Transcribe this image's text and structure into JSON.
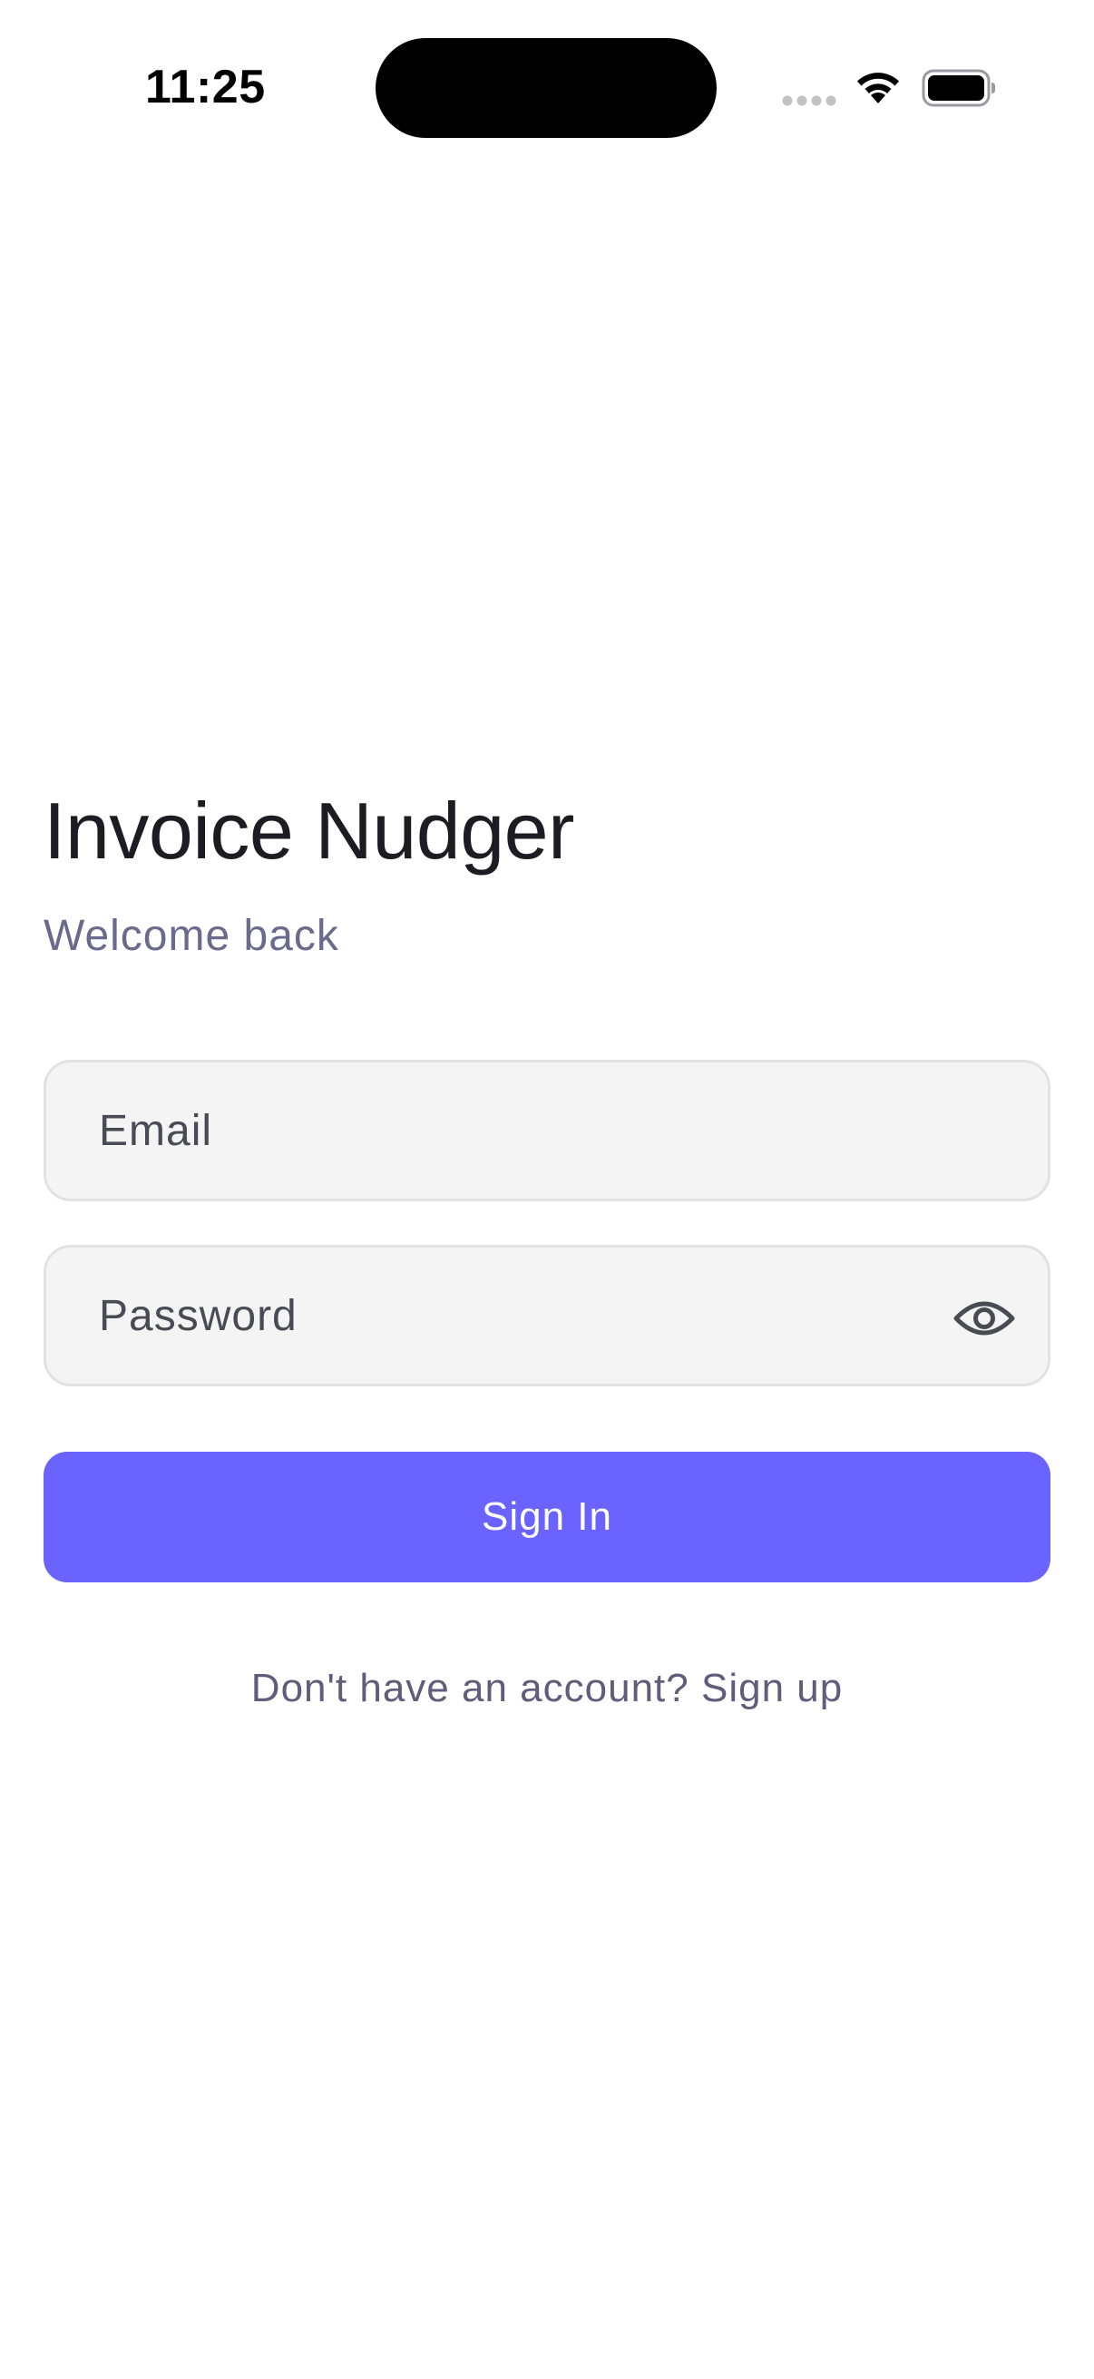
{
  "status_bar": {
    "time": "11:25",
    "icons": [
      "cellular-signal-icon",
      "wifi-icon",
      "battery-icon"
    ]
  },
  "header": {
    "title": "Invoice Nudger",
    "subtitle": "Welcome back"
  },
  "form": {
    "email": {
      "placeholder": "Email",
      "value": ""
    },
    "password": {
      "placeholder": "Password",
      "value": "",
      "toggle_icon": "eye-icon"
    },
    "submit_label": "Sign In"
  },
  "footer": {
    "signup_text": "Don't have an account? Sign up"
  },
  "colors": {
    "accent": "#6b63ff",
    "title": "#1c1c22",
    "muted": "#6a6a8c",
    "field_bg": "#f4f4f5",
    "field_border": "#e2e2e6"
  }
}
